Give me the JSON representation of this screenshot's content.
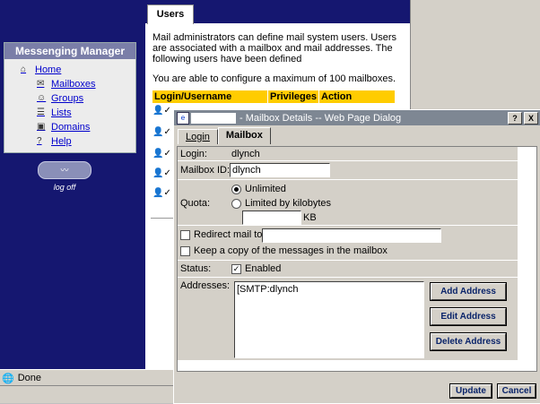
{
  "nav": {
    "title": "Messenging Manager",
    "items": [
      {
        "label": "Home",
        "icon": "home-icon"
      },
      {
        "label": "Mailboxes",
        "icon": "mailbox-icon"
      },
      {
        "label": "Groups",
        "icon": "group-icon"
      },
      {
        "label": "Lists",
        "icon": "list-icon"
      },
      {
        "label": "Domains",
        "icon": "domain-icon"
      },
      {
        "label": "Help",
        "icon": "help-icon"
      }
    ],
    "logoff_label": "log off"
  },
  "content": {
    "tab": "Users",
    "intro": "Mail administrators can define mail system users. Users are associated with a mailbox and mail addresses. The following users have been defined",
    "limit": "You are able to configure a maximum of 100 mailboxes.",
    "columns": [
      "Login/Username",
      "Privileges",
      "Action"
    ]
  },
  "statusbar": {
    "text": "Done"
  },
  "dialog": {
    "title": "- Mailbox Details -- Web Page Dialog",
    "help_btn": "?",
    "close_btn": "X",
    "tabs": [
      "Login",
      "Mailbox"
    ],
    "login_label": "Login:",
    "login_value": "dlynch",
    "mailbox_id_label": "Mailbox ID:",
    "mailbox_id_value": "dlynch",
    "quota_label": "Quota:",
    "quota_unlimited": "Unlimited",
    "quota_limited": "Limited by kilobytes",
    "quota_unit": "KB",
    "redirect_label": "Redirect mail to",
    "keep_copy_label": "Keep a copy of the messages in the mailbox",
    "status_label": "Status:",
    "enabled_label": "Enabled",
    "addresses_label": "Addresses:",
    "addresses": [
      "[SMTP:dlynch"
    ],
    "add_address": "Add Address",
    "edit_address": "Edit Address",
    "delete_address": "Delete Address",
    "update": "Update",
    "cancel": "Cancel"
  }
}
